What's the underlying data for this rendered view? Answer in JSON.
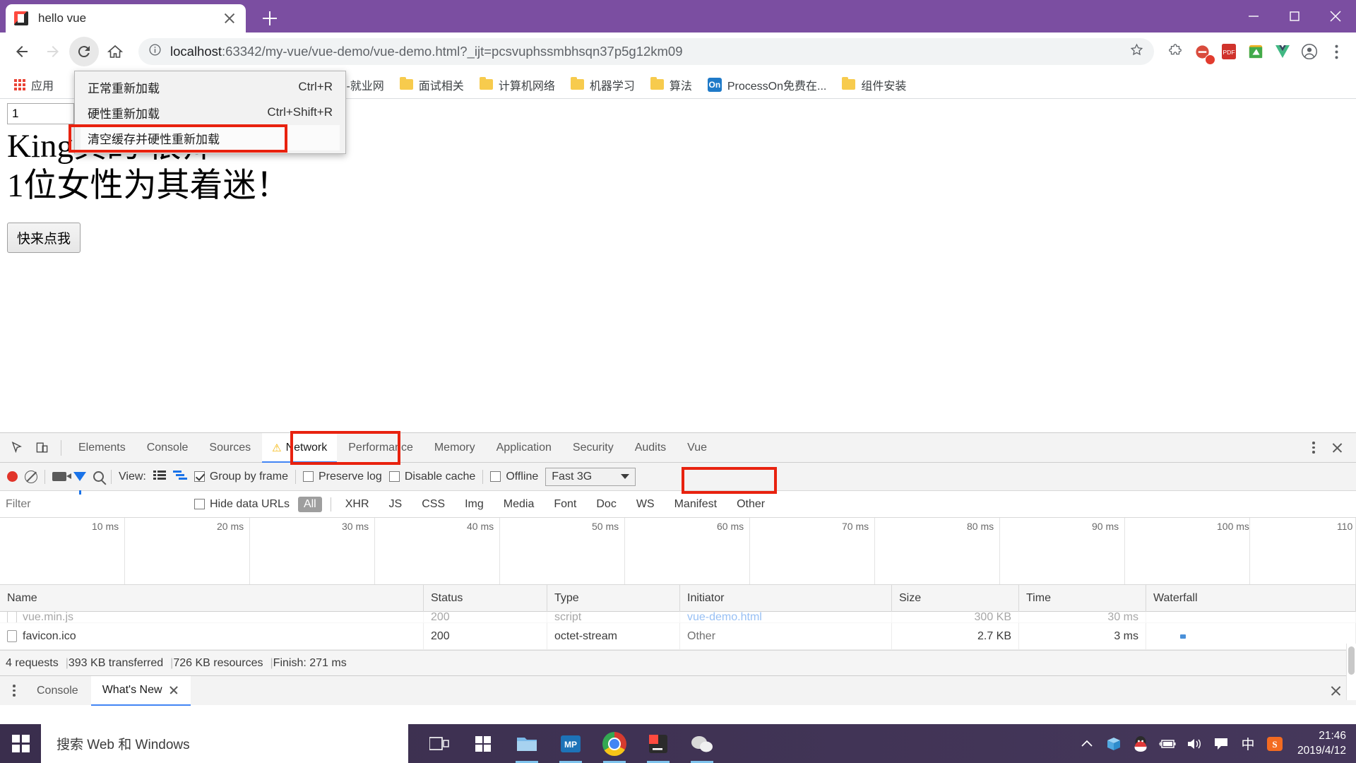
{
  "browser": {
    "tab": {
      "title": "hello vue",
      "favicon": "jetbrains-icon",
      "close": "close-tab-icon"
    },
    "newtab_label": "+",
    "window_controls": {
      "minimize": "minimize-icon",
      "maximize": "maximize-icon",
      "close": "close-window-icon"
    },
    "toolbar": {
      "back": "back-arrow-icon",
      "forward": "forward-arrow-icon",
      "reload": "reload-icon",
      "home": "home-icon",
      "site_info": "info-icon",
      "url_host": "localhost",
      "url_rest": ":63342/my-vue/vue-demo/vue-demo.html?_ijt=pcsvuphssmbhsqn37p5g12km09",
      "bookmark_star": "star-icon",
      "extensions": [
        "puzzle-icon",
        "adblock-icon",
        "pdf-icon",
        "screenshot-icon",
        "vue-devtools-icon"
      ],
      "profile": "profile-avatar-icon",
      "menu": "three-dot-menu-icon"
    },
    "bookmarks": [
      {
        "label": "应用",
        "icon": "apps-grid-icon"
      },
      {
        "label": "四川大学 -就业网",
        "icon": "page-icon"
      },
      {
        "label": "面试相关",
        "icon": "folder-icon"
      },
      {
        "label": "计算机网络",
        "icon": "folder-icon"
      },
      {
        "label": "机器学习",
        "icon": "folder-icon"
      },
      {
        "label": "算法",
        "icon": "folder-icon"
      },
      {
        "label": "ProcessOn免费在...",
        "icon": "on-icon"
      },
      {
        "label": "组件安装",
        "icon": "folder-icon"
      }
    ],
    "context_menu": {
      "items": [
        {
          "label": "正常重新加载",
          "accel": "Ctrl+R",
          "highlighted": false
        },
        {
          "label": "硬性重新加载",
          "accel": "Ctrl+Shift+R",
          "highlighted": false
        },
        {
          "label": "清空缓存并硬性重新加载",
          "accel": "",
          "highlighted": true
        }
      ],
      "highlight_color": "#e8220f"
    }
  },
  "page": {
    "input_value": "1",
    "heading_line1": "King真的  很帅",
    "heading_line2": "1位女性为其着迷！",
    "button_label": "快来点我"
  },
  "devtools": {
    "left_icons": [
      "inspect-element-icon",
      "device-toolbar-icon"
    ],
    "tabs": [
      {
        "label": "Elements",
        "active": false,
        "warning": false
      },
      {
        "label": "Console",
        "active": false,
        "warning": false
      },
      {
        "label": "Sources",
        "active": false,
        "warning": false
      },
      {
        "label": "Network",
        "active": true,
        "warning": true
      },
      {
        "label": "Performance",
        "active": false,
        "warning": false
      },
      {
        "label": "Memory",
        "active": false,
        "warning": false
      },
      {
        "label": "Application",
        "active": false,
        "warning": false
      },
      {
        "label": "Security",
        "active": false,
        "warning": false
      },
      {
        "label": "Audits",
        "active": false,
        "warning": false
      },
      {
        "label": "Vue",
        "active": false,
        "warning": false
      }
    ],
    "network_toolbar": {
      "record": "record-icon",
      "clear": "clear-icon",
      "capture_screenshots": "camera-icon",
      "filter": "funnel-icon",
      "search": "search-icon",
      "view_label": "View:",
      "view_list_icon": "list-view-icon",
      "view_waterfall_icon": "waterfall-view-icon",
      "group_by_frame": {
        "label": "Group by frame",
        "checked": true
      },
      "preserve_log": {
        "label": "Preserve log",
        "checked": false
      },
      "disable_cache": {
        "label": "Disable cache",
        "checked": false
      },
      "offline": {
        "label": "Offline",
        "checked": false
      },
      "throttle": {
        "value": "Fast 3G",
        "caret": "chevron-down-icon"
      }
    },
    "filter_bar": {
      "placeholder": "Filter",
      "hide_data_urls": {
        "label": "Hide data URLs",
        "checked": false
      },
      "types": [
        "All",
        "XHR",
        "JS",
        "CSS",
        "Img",
        "Media",
        "Font",
        "Doc",
        "WS",
        "Manifest",
        "Other"
      ],
      "selected_type": "All"
    },
    "timeline_ticks": [
      "10 ms",
      "20 ms",
      "30 ms",
      "40 ms",
      "50 ms",
      "60 ms",
      "70 ms",
      "80 ms",
      "90 ms",
      "100 ms",
      "110"
    ],
    "table": {
      "columns": [
        "Name",
        "Status",
        "Type",
        "Initiator",
        "Size",
        "Time",
        "Waterfall"
      ],
      "rows": [
        {
          "name": "vue.min.js",
          "status": "200",
          "type": "script",
          "initiator": "vue-demo.html",
          "size": "300 KB",
          "time": "30 ms",
          "clipped": true
        },
        {
          "name": "favicon.ico",
          "status": "200",
          "type": "octet-stream",
          "initiator": "Other",
          "size": "2.7 KB",
          "time": "3 ms",
          "clipped": false
        }
      ]
    },
    "summary": {
      "requests": "4 requests",
      "transferred": "393 KB transferred",
      "resources": "726 KB resources",
      "finish": "Finish: 271 ms"
    },
    "drawer": {
      "menu_icon": "drawer-menu-icon",
      "tabs": [
        {
          "label": "Console",
          "active": false,
          "closable": false
        },
        {
          "label": "What's New",
          "active": true,
          "closable": true
        }
      ],
      "close": "close-drawer-icon"
    },
    "more_menu": "three-dot-menu-icon",
    "close": "close-devtools-icon"
  },
  "taskbar": {
    "start": "windows-logo-icon",
    "search_placeholder": "搜索 Web 和 Windows",
    "pinned": [
      {
        "name": "task-view-icon"
      },
      {
        "name": "store-icon"
      },
      {
        "name": "explorer-icon"
      },
      {
        "name": "mp-icon"
      },
      {
        "name": "chrome-icon",
        "running": true
      },
      {
        "name": "jetbrains-icon",
        "running": true
      },
      {
        "name": "wechat-icon",
        "running": true
      }
    ],
    "tray": [
      {
        "name": "show-hidden-icons-icon"
      },
      {
        "name": "onedrive-icon"
      },
      {
        "name": "qq-icon"
      },
      {
        "name": "battery-icon"
      },
      {
        "name": "volume-icon"
      },
      {
        "name": "action-center-icon"
      },
      {
        "name": "ime-chinese-icon",
        "label": "中"
      },
      {
        "name": "sogou-icon"
      }
    ],
    "clock_time": "21:46",
    "clock_date": "2019/4/12"
  }
}
